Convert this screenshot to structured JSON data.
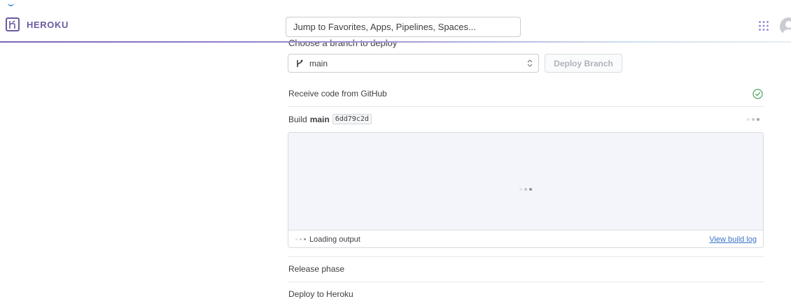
{
  "header": {
    "brand_name": "HEROKU",
    "search_placeholder": "Jump to Favorites, Apps, Pipelines, Spaces...",
    "accent_color": "#6b5aa3"
  },
  "deploy": {
    "section_heading_clipped": "Choose a branch to deploy",
    "branch_select_value": "main",
    "deploy_button_label": "Deploy Branch"
  },
  "steps": {
    "receive_label": "Receive code from GitHub",
    "receive_status_icon": "check-circle-icon",
    "build_prefix": "Build",
    "build_branch": "main",
    "build_commit": "6dd79c2d",
    "loading_output": "Loading output",
    "view_build_log": "View build log",
    "release_phase": "Release phase",
    "deploy_to_heroku": "Deploy to Heroku"
  }
}
